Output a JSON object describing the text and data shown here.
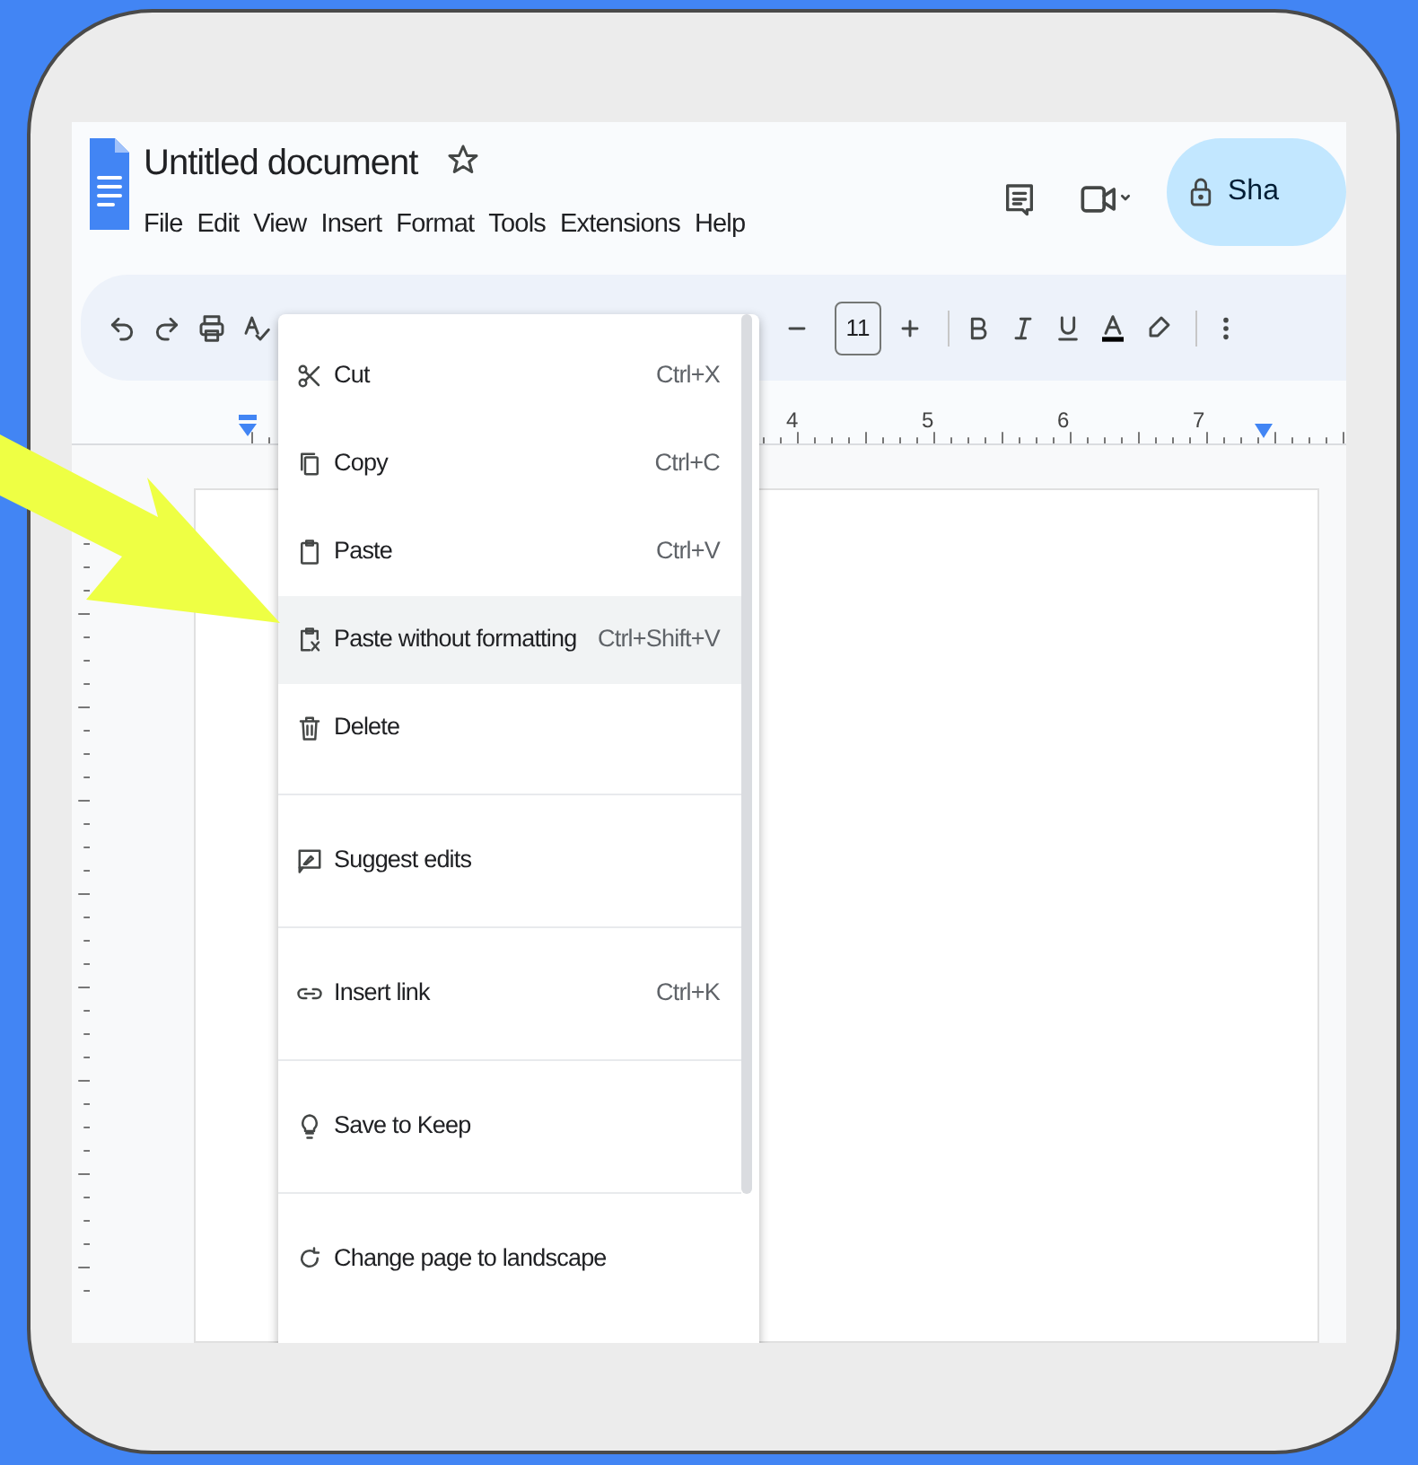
{
  "document": {
    "title": "Untitled document"
  },
  "menubar": [
    "File",
    "Edit",
    "View",
    "Insert",
    "Format",
    "Tools",
    "Extensions",
    "Help"
  ],
  "share_button": {
    "label": "Sha"
  },
  "toolbar": {
    "font_size": "11"
  },
  "ruler": {
    "labels": [
      "4",
      "5",
      "6",
      "7"
    ]
  },
  "context_menu": {
    "items": [
      {
        "kind": "item",
        "label": "Cut",
        "shortcut": "Ctrl+X",
        "selected": false
      },
      {
        "kind": "item",
        "label": "Copy",
        "shortcut": "Ctrl+C",
        "selected": false
      },
      {
        "kind": "item",
        "label": "Paste",
        "shortcut": "Ctrl+V",
        "selected": false
      },
      {
        "kind": "item",
        "label": "Paste without formatting",
        "shortcut": "Ctrl+Shift+V",
        "selected": true
      },
      {
        "kind": "item",
        "label": "Delete",
        "selected": false
      },
      {
        "kind": "divider"
      },
      {
        "kind": "item",
        "label": "Suggest edits",
        "selected": false
      },
      {
        "kind": "divider"
      },
      {
        "kind": "item",
        "label": "Insert link",
        "shortcut": "Ctrl+K",
        "selected": false
      },
      {
        "kind": "divider"
      },
      {
        "kind": "item",
        "label": "Save to Keep",
        "selected": false
      },
      {
        "kind": "divider"
      },
      {
        "kind": "item",
        "label": "Change page to landscape",
        "selected": false
      }
    ]
  }
}
